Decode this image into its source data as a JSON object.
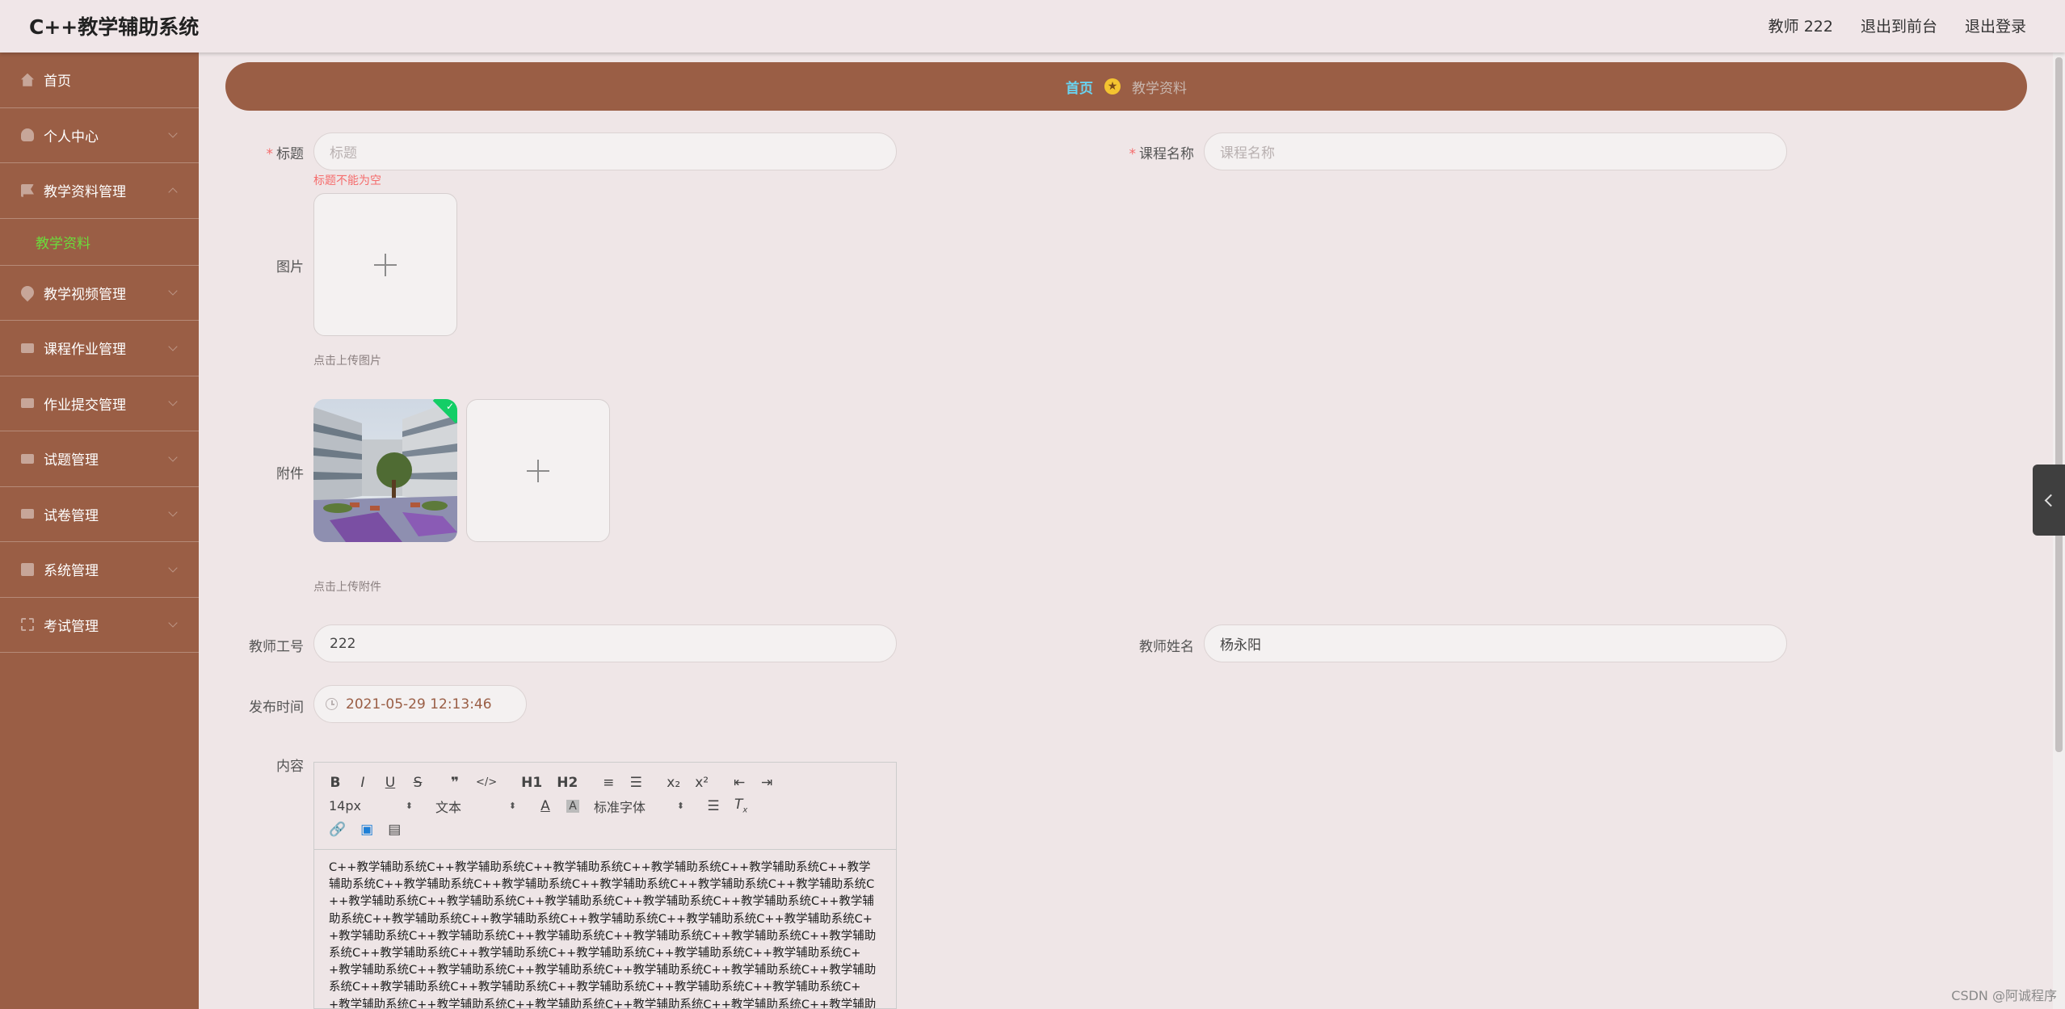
{
  "header": {
    "title": "C++教学辅助系统",
    "user": "教师 222",
    "front_link": "退出到前台",
    "logout_link": "退出登录"
  },
  "sidebar": {
    "items": [
      {
        "label": "首页",
        "icon": "home-icon"
      },
      {
        "label": "个人中心",
        "icon": "user-icon"
      },
      {
        "label": "教学资料管理",
        "icon": "flag-icon",
        "expanded": true
      },
      {
        "label": "教学视频管理",
        "icon": "location-icon"
      },
      {
        "label": "课程作业管理",
        "icon": "edit-icon"
      },
      {
        "label": "作业提交管理",
        "icon": "ticket-icon"
      },
      {
        "label": "试题管理",
        "icon": "message-icon"
      },
      {
        "label": "试卷管理",
        "icon": "suitcase-icon"
      },
      {
        "label": "系统管理",
        "icon": "clipboard-icon"
      },
      {
        "label": "考试管理",
        "icon": "fullscreen-icon"
      }
    ],
    "subitem": "教学资料"
  },
  "breadcrumb": {
    "home": "首页",
    "current": "教学资料"
  },
  "form": {
    "title_label": "标题",
    "title_placeholder": "标题",
    "title_error": "标题不能为空",
    "course_label": "课程名称",
    "course_placeholder": "课程名称",
    "image_label": "图片",
    "image_hint": "点击上传图片",
    "attachment_label": "附件",
    "attachment_hint": "点击上传附件",
    "teacher_id_label": "教师工号",
    "teacher_id_value": "222",
    "teacher_name_label": "教师姓名",
    "teacher_name_value": "杨永阳",
    "publish_time_label": "发布时间",
    "publish_time_value": "2021-05-29 12:13:46",
    "content_label": "内容"
  },
  "editor": {
    "toolbar_row1": [
      "B",
      "I",
      "U",
      "S",
      "❞",
      "</>",
      "H1",
      "H2",
      "≡",
      "☰",
      "x₂",
      "x²",
      "⇤",
      "⇥"
    ],
    "font_size": "14px",
    "text_style": "文本",
    "font_family": "标准字体",
    "content": "C++教学辅助系统C++教学辅助系统C++教学辅助系统C++教学辅助系统C++教学辅助系统C++教学辅助系统C++教学辅助系统C++教学辅助系统C++教学辅助系统C++教学辅助系统C++教学辅助系统C++教学辅助系统C++教学辅助系统C++教学辅助系统C++教学辅助系统C++教学辅助系统C++教学辅助系统C++教学辅助系统C++教学辅助系统C++教学辅助系统C++教学辅助系统C++教学辅助系统C++教学辅助系统C++教学辅助系统C++教学辅助系统C++教学辅助系统C++教学辅助系统C++教学辅助系统C++教学辅助系统C++教学辅助系统C++教学辅助系统C++教学辅助系统C++教学辅助系统C++教学辅助系统C++教学辅助系统C++教学辅助系统C++教学辅助系统C++教学辅助系统C++教学辅助系统C++教学辅助系统C++教学辅助系统C++教学辅助系统C++教学辅助系统C++教学辅助系统C++教学辅助系统C++教学辅助系统C++教学辅助系统C++教学辅助系统C++教学辅助系统C++教学辅助系统C++教学辅助系统C++教学辅助系统C++教学辅助系统C++教学辅助系统C++教学辅助系统C++教学辅助系统C++教学辅助系统C++教学辅助系统C++教学辅助系统C++教学辅助系统"
  },
  "watermark": "CSDN @阿诚程序",
  "colors": {
    "sidebar_bg": "#9a5e45",
    "accent_green": "#6bdc3c",
    "required": "#f56c6c",
    "breadcrumb_home": "#6ad3f0"
  }
}
